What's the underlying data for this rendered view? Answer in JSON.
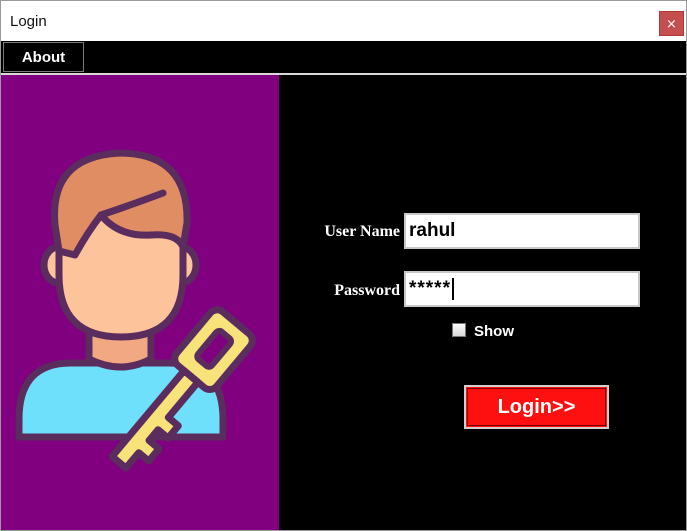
{
  "window": {
    "title": "Login",
    "close_glyph": "×"
  },
  "menu": {
    "items": [
      {
        "label": "About"
      }
    ]
  },
  "form": {
    "username_label": "User Name",
    "username_value": "rahul",
    "password_label": "Password",
    "password_value": "*****",
    "show_label": "Show",
    "show_checked": false,
    "login_button": "Login>>"
  },
  "illustration": {
    "icon": "user-key-icon"
  },
  "colors": {
    "left_panel": "#800080",
    "right_panel": "#000000",
    "login_button": "#ff1010",
    "close_button": "#c44f4f"
  }
}
